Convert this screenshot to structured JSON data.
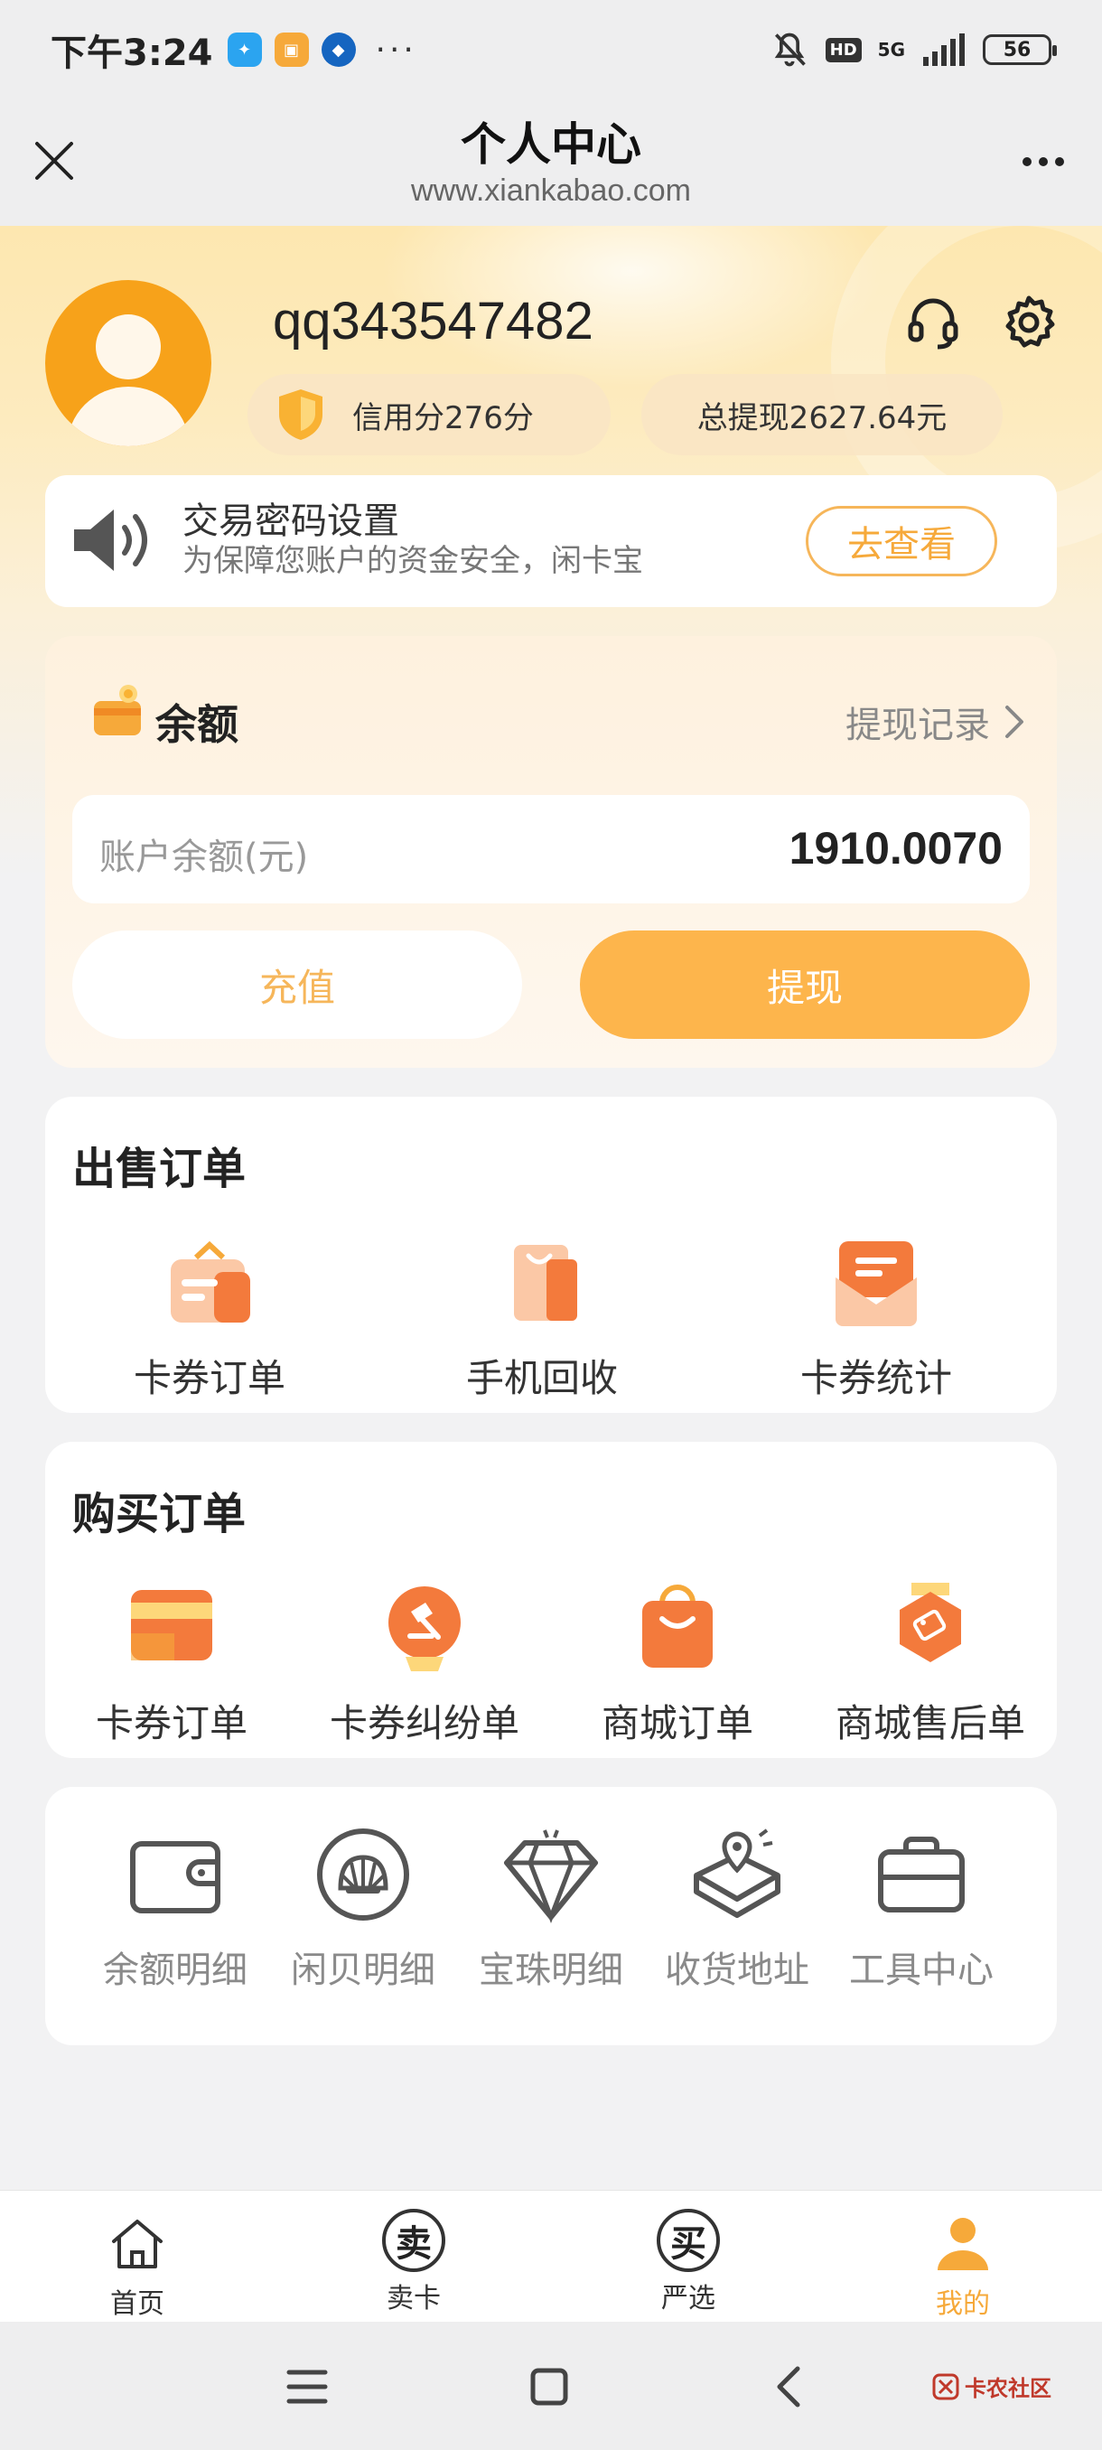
{
  "status_bar": {
    "time": "下午3:24",
    "battery": "56",
    "network": "5G",
    "hd": "HD",
    "more": "···"
  },
  "header": {
    "title": "个人中心",
    "subtitle": "www.xiankabao.com"
  },
  "profile": {
    "username": "qq343547482",
    "credit_label": "信用分276分",
    "total_withdraw_label": "总提现2627.64元"
  },
  "notice": {
    "title": "交易密码设置",
    "text_line1": "为保障您账户的资金安全，闲卡宝",
    "text_line2_prefix": "...",
    "text_line2_red": "",
    "button": "去查看"
  },
  "balance": {
    "title": "余额",
    "record_link": "提现记录",
    "account_label": "账户余额(元)",
    "account_value": "1910.0070",
    "recharge": "充值",
    "withdraw": "提现"
  },
  "sell_orders": {
    "title": "出售订单",
    "items": [
      {
        "label": "卡券订单",
        "icon": "bag-card-icon"
      },
      {
        "label": "手机回收",
        "icon": "shopping-bag-icon"
      },
      {
        "label": "卡券统计",
        "icon": "envelope-icon"
      }
    ]
  },
  "buy_orders": {
    "title": "购买订单",
    "items": [
      {
        "label": "卡券订单",
        "icon": "card-icon"
      },
      {
        "label": "卡券纠纷单",
        "icon": "gavel-icon"
      },
      {
        "label": "商城订单",
        "icon": "shopping-bag-icon"
      },
      {
        "label": "商城售后单",
        "icon": "tag-badge-icon"
      }
    ]
  },
  "tools": {
    "items": [
      {
        "label": "余额明细",
        "icon": "wallet-icon"
      },
      {
        "label": "闲贝明细",
        "icon": "shell-icon"
      },
      {
        "label": "宝珠明细",
        "icon": "diamond-icon"
      },
      {
        "label": "收货地址",
        "icon": "location-box-icon"
      },
      {
        "label": "工具中心",
        "icon": "toolbox-icon"
      }
    ]
  },
  "tabbar": {
    "items": [
      {
        "label": "首页",
        "icon": "home-icon"
      },
      {
        "label": "卖卡",
        "icon": "sell-icon",
        "glyph": "卖"
      },
      {
        "label": "严选",
        "icon": "buy-icon",
        "glyph": "买"
      },
      {
        "label": "我的",
        "icon": "user-icon"
      }
    ],
    "active_index": 3,
    "accent": "#f6a93a"
  },
  "system_nav": {
    "watermark": "卡农社区"
  },
  "colors": {
    "accent": "#fdb54c",
    "accent_text": "#f6a93a",
    "avatar": "#f7a21a",
    "notice_red": "#e53935"
  }
}
